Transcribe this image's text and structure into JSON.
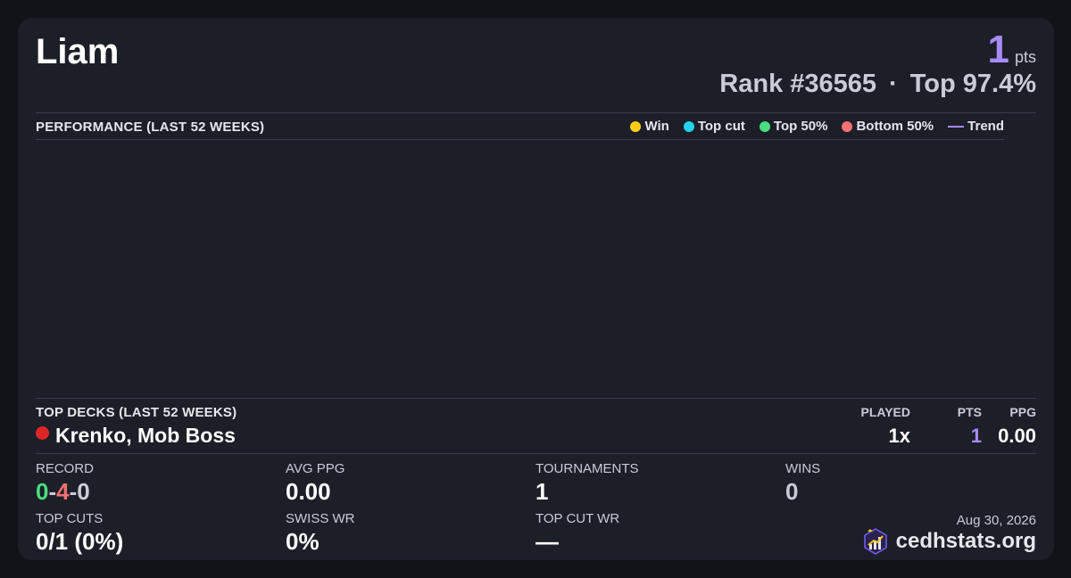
{
  "player": {
    "name": "Liam",
    "points": "1",
    "points_label": "pts",
    "rank": "Rank #36565",
    "separator": "·",
    "top_percent": "Top 97.4%"
  },
  "performance": {
    "title": "PERFORMANCE (LAST 52 WEEKS)",
    "legend": [
      {
        "label": "Win",
        "color": "#facc15",
        "kind": "dot"
      },
      {
        "label": "Top cut",
        "color": "#22d3ee",
        "kind": "dot"
      },
      {
        "label": "Top 50%",
        "color": "#4ade80",
        "kind": "dot"
      },
      {
        "label": "Bottom 50%",
        "color": "#f87171",
        "kind": "dot"
      },
      {
        "label": "Trend",
        "color": "#a78bfa",
        "kind": "line"
      }
    ]
  },
  "top_decks": {
    "title": "TOP DECKS (LAST 52 WEEKS)",
    "headers": {
      "played": "PLAYED",
      "pts": "PTS",
      "ppg": "PPG"
    },
    "deck": {
      "name": "Krenko, Mob Boss",
      "color": "#dc2626",
      "played": "1x",
      "pts": "1",
      "ppg": "0.00"
    }
  },
  "stats": {
    "record": {
      "label": "RECORD",
      "wins": "0",
      "losses": "4",
      "draws": "0",
      "sep": "-"
    },
    "avg_ppg": {
      "label": "AVG PPG",
      "value": "0.00"
    },
    "tournaments": {
      "label": "TOURNAMENTS",
      "value": "1"
    },
    "wins": {
      "label": "WINS",
      "value": "0"
    },
    "top_cuts": {
      "label": "TOP CUTS",
      "value": "0/1 (0%)"
    },
    "swiss_wr": {
      "label": "SWISS WR",
      "value": "0%"
    },
    "top_cut_wr": {
      "label": "TOP CUT WR",
      "value": "—"
    }
  },
  "footer": {
    "date": "Aug 30, 2026",
    "brand": "cedhstats.org",
    "icon": "chart-logo-icon"
  },
  "colors": {
    "accent": "#a78bfa",
    "win_green": "#4ade80",
    "loss_red": "#f87171",
    "muted": "#c9cbd6"
  }
}
